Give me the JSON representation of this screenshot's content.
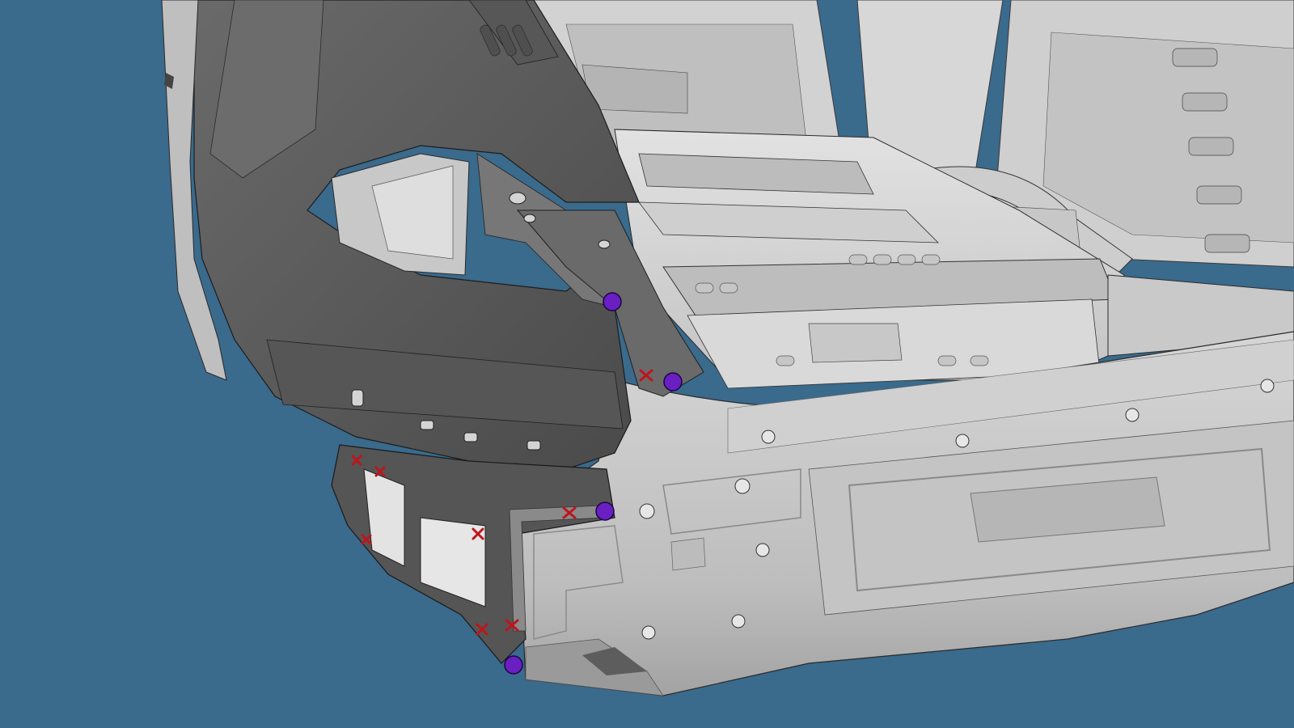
{
  "viewport": {
    "background_color": "#3a6a8c",
    "model": "body-in-white-rear-structure",
    "render_mode": "shaded-with-edges"
  },
  "palette": {
    "highlighted_part": "#5c5c5c",
    "highlighted_part_dark": "#464646",
    "body_panel": "#c9c9c9",
    "body_panel_light": "#dadada",
    "body_panel_shadow": "#9d9d9d",
    "edge_line": "#2a2a2a",
    "locator_pin": "#6a1fc2",
    "weld_mark": "#c0141c"
  },
  "markers": {
    "locator_pins": 4,
    "weld_marks": 8
  }
}
